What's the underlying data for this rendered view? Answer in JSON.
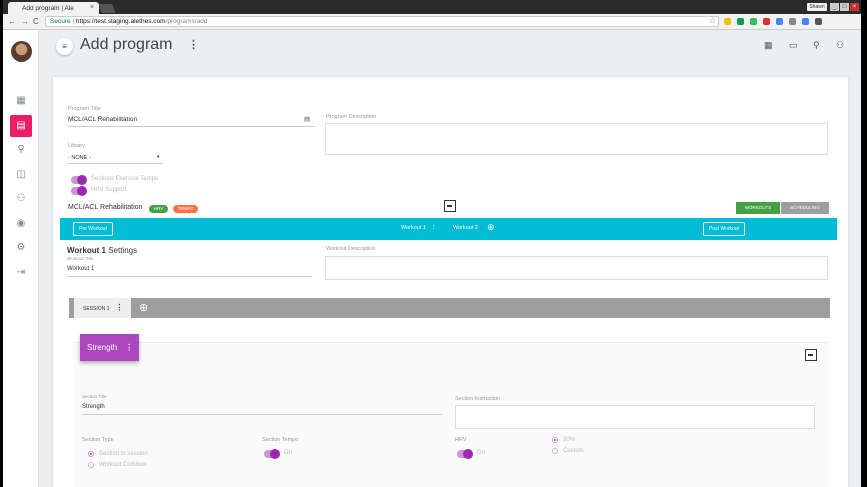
{
  "browser": {
    "tab_title": "Add program | Ale",
    "tab_close": "×",
    "user_chip": "Shawn",
    "win_min": "_",
    "win_max": "□",
    "win_close": "×",
    "url_secure": "Secure",
    "url_sep": " | ",
    "url_host": "https://test.staging.alethes.com",
    "url_path": "/programs/add",
    "back": "←",
    "forward": "→",
    "reload": "C",
    "star": "☆",
    "ext_colors": [
      "#f4c20d",
      "#0f9d58",
      "#3cba54",
      "#db3236",
      "#4885ed",
      "#888888",
      "#4285f4",
      "#555555"
    ]
  },
  "sidebar": {
    "icons": [
      "dashboard-icon",
      "programs-icon",
      "exercise-icon",
      "library-icon",
      "people-icon",
      "account-icon",
      "settings-icon",
      "logout-icon"
    ],
    "glyphs": [
      "▦",
      "▤",
      "⚲",
      "◫",
      "⚇",
      "◉",
      "⚙",
      "⇥"
    ],
    "active_index": 1
  },
  "header": {
    "menu_glyph": "≡",
    "title": "Add program",
    "dots": "⋮",
    "icons": [
      "▦",
      "▭",
      "⚲",
      "⚇"
    ]
  },
  "program": {
    "title_label": "Program Title",
    "title_value": "MCL/ACL Rehabilitation",
    "title_icon": "▤",
    "desc_label": "Program Description",
    "library_label": "Library",
    "library_value": "- NONE -",
    "library_caret": "▾",
    "toggle1_label": "Sections Exercise Tempo",
    "toggle2_label": "HRV Support",
    "name": "MCL/ACL Rehabilitation",
    "badge_green": "HRV",
    "badge_orange": "TEMPO",
    "workouts_btn": "WORKOUTS",
    "scheduling_btn": "SCHEDULING"
  },
  "workouts_strip": {
    "pre": "Pre Workout",
    "tab1": "Workout 1",
    "tab1_dots": "⋮",
    "tab2": "Workout 2",
    "add": "⊕",
    "post": "Post Workout"
  },
  "workout": {
    "heading_bold": "Workout 1",
    "heading_rest": " Settings",
    "title_label": "Workout Title",
    "title_value": "Workout 1",
    "desc_label": "Workout Description"
  },
  "session": {
    "tab": "SESSION 1",
    "dots": "⋮",
    "add": "⊕"
  },
  "section": {
    "chip": "Strength",
    "chip_dots": "⋮",
    "title_label": "Section Title",
    "title_value": "Strength",
    "instruction_label": "Section Instruction",
    "type_label": "Section Type",
    "type_opt1": "Section to session",
    "type_opt2": "Workout Common",
    "tempo_label": "Section Tempo",
    "tempo_value": "On",
    "hrv_label": "HRV",
    "hrv_value": "On",
    "hrv_opt1": "30%",
    "hrv_opt2": "Custom"
  }
}
